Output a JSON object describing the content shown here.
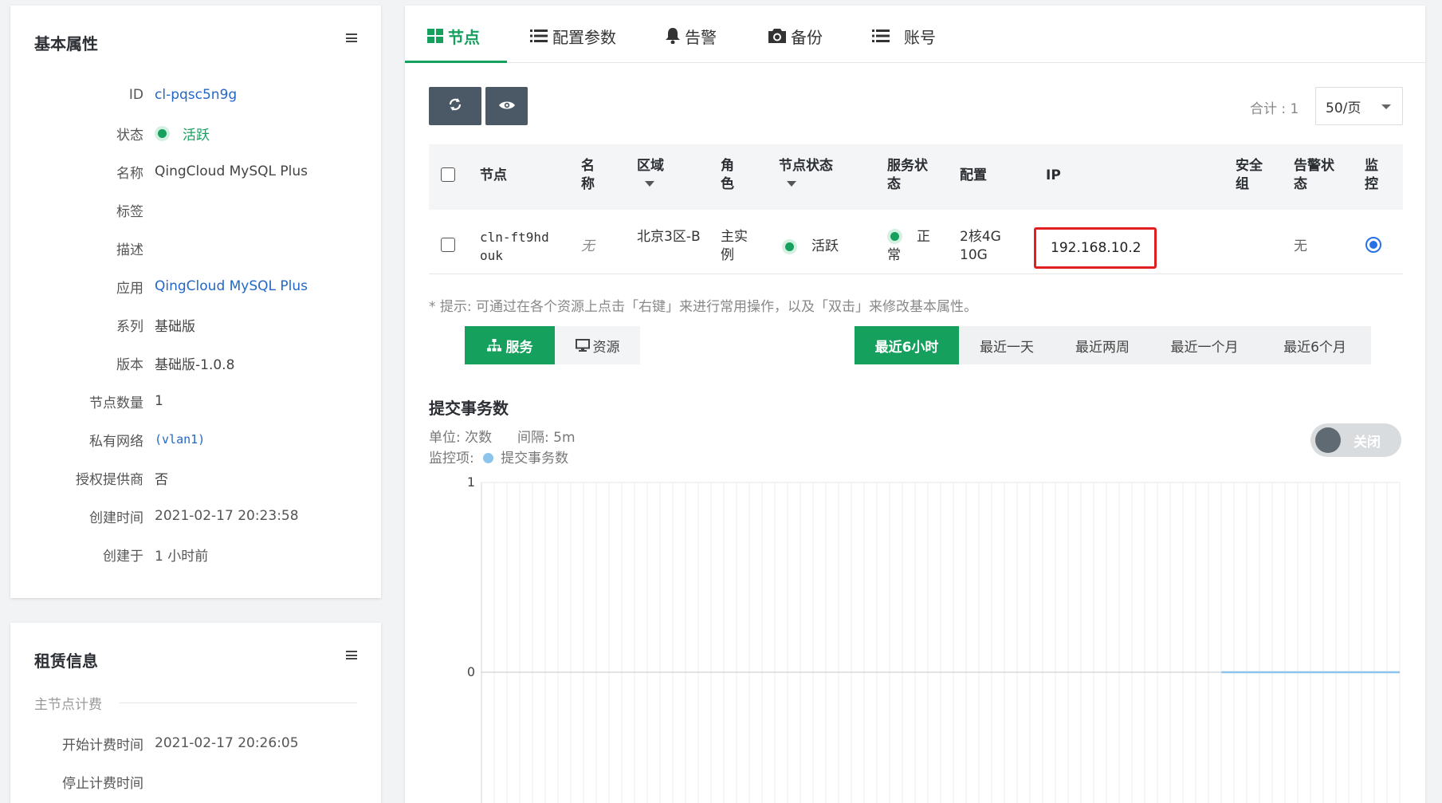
{
  "basic": {
    "title": "基本属性",
    "rows": [
      {
        "label": "ID",
        "value": "cl-pqsc5n9g"
      },
      {
        "label": "状态",
        "value": "活跃"
      },
      {
        "label": "名称",
        "value": "QingCloud MySQL Plus"
      },
      {
        "label": "标签",
        "value": ""
      },
      {
        "label": "描述",
        "value": ""
      },
      {
        "label": "应用",
        "value": "QingCloud MySQL Plus"
      },
      {
        "label": "系列",
        "value": "基础版"
      },
      {
        "label": "版本",
        "value": "基础版-1.0.8"
      },
      {
        "label": "节点数量",
        "value": "1"
      },
      {
        "label": "私有网络",
        "value": "(vlan1)"
      },
      {
        "label": "授权提供商",
        "value": "否"
      },
      {
        "label": "创建时间",
        "value": "2021-02-17 20:23:58"
      },
      {
        "label": "创建于",
        "value": "1 小时前"
      }
    ]
  },
  "lease": {
    "title": "租赁信息",
    "section": "主节点计费",
    "rows": [
      {
        "label": "开始计费时间",
        "value": "2021-02-17 20:26:05"
      },
      {
        "label": "停止计费时间",
        "value": ""
      }
    ]
  },
  "tabs": [
    {
      "label": "节点",
      "icon": "grid-icon"
    },
    {
      "label": "配置参数",
      "icon": "list-icon"
    },
    {
      "label": "告警",
      "icon": "bell-icon"
    },
    {
      "label": "备份",
      "icon": "camera-icon"
    },
    {
      "label": "账号",
      "icon": "list-icon"
    }
  ],
  "toolbar": {
    "refresh_icon": "refresh-icon",
    "view_icon": "eye-icon",
    "total": "合计 : 1",
    "page_size": "50/页"
  },
  "table": {
    "headers": {
      "node": "节点",
      "name": "名称",
      "zone": "区域",
      "role": "角色",
      "node_status": "节点状态",
      "service_status": "服务状态",
      "config": "配置",
      "ip": "IP",
      "security_group": "安全组",
      "alarm_status": "告警状态",
      "monitor": "监控"
    },
    "rows": [
      {
        "node": "cln-ft9hdouk",
        "name": "无",
        "zone": "北京3区-B",
        "role": "主实例",
        "node_status": "活跃",
        "service_status": "正常",
        "config": "2核4G 10G",
        "ip": "192.168.10.2",
        "security_group": "",
        "alarm_status": "无",
        "monitor_checked": true
      }
    ]
  },
  "hint": "* 提示: 可通过在各个资源上点击「右键」来进行常用操作，以及「双击」来修改基本属性。",
  "views": {
    "service": "服务",
    "resource": "资源"
  },
  "ranges": [
    "最近6小时",
    "最近一天",
    "最近两周",
    "最近一个月",
    "最近6个月"
  ],
  "chart_panel": {
    "title": "提交事务数",
    "unit": "单位: 次数",
    "interval": "间隔: 5m",
    "monitor_label": "监控项:",
    "toggle_label": "关闭"
  },
  "chart_data": {
    "type": "line",
    "title": "提交事务数",
    "xlabel": "",
    "ylabel": "",
    "ylim": [
      0,
      1
    ],
    "y_ticks": [
      "1",
      "0"
    ],
    "grid": true,
    "legend": "top-left",
    "num_x_gridlines": 72,
    "series": [
      {
        "name": "提交事务数",
        "color": "#8cc4ec",
        "x_fraction": [
          0.806,
          1.0
        ],
        "values": [
          0,
          0
        ]
      }
    ]
  },
  "colors": {
    "accent": "#16a05d",
    "link": "#2467c6",
    "highlight": "#e02020",
    "toolbar": "#4b5966"
  }
}
